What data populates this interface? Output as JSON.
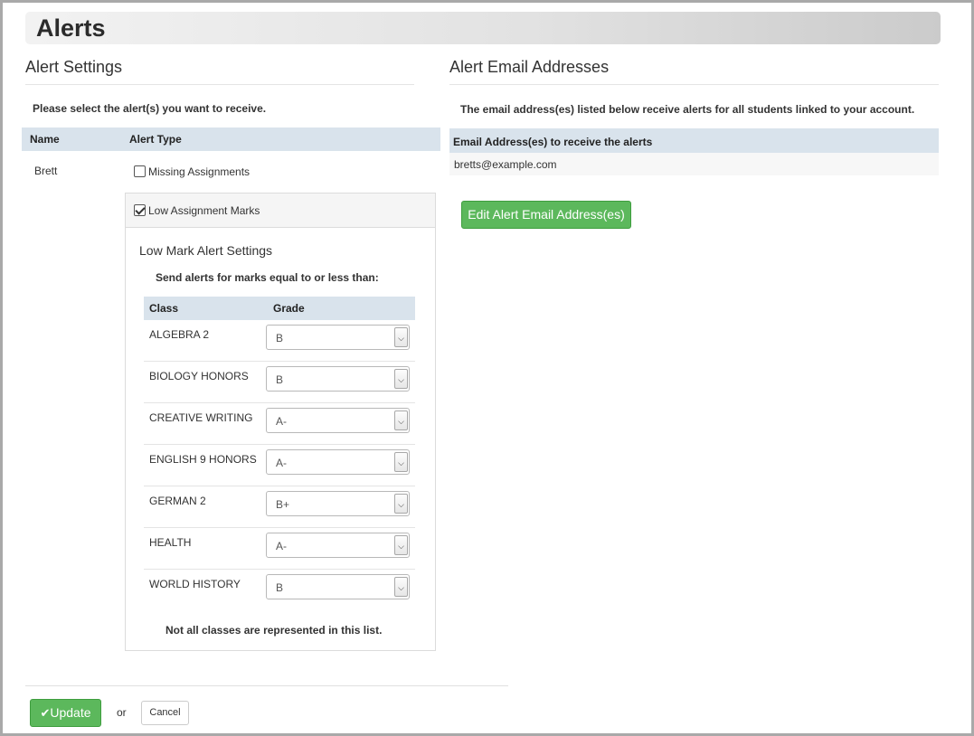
{
  "page": {
    "title": "Alerts"
  },
  "alert_settings": {
    "heading": "Alert Settings",
    "instruction": "Please select the alert(s) you want to receive.",
    "columns": {
      "name": "Name",
      "alert_type": "Alert Type"
    },
    "student": "Brett",
    "alerts": {
      "missing": {
        "label": "Missing Assignments",
        "checked": false
      },
      "low_marks": {
        "label": "Low Assignment Marks",
        "checked": true
      }
    },
    "low_mark": {
      "heading": "Low Mark Alert Settings",
      "instruction": "Send alerts for marks equal to or less than:",
      "columns": {
        "class": "Class",
        "grade": "Grade"
      },
      "rows": [
        {
          "class": "ALGEBRA 2",
          "grade": "B"
        },
        {
          "class": "BIOLOGY HONORS",
          "grade": "B"
        },
        {
          "class": "CREATIVE WRITING",
          "grade": "A-"
        },
        {
          "class": "ENGLISH 9 HONORS",
          "grade": "A-"
        },
        {
          "class": "GERMAN 2",
          "grade": "B+"
        },
        {
          "class": "HEALTH",
          "grade": "A-"
        },
        {
          "class": "WORLD HISTORY",
          "grade": "B"
        }
      ],
      "note": "Not all classes are represented in this list."
    }
  },
  "email_settings": {
    "heading": "Alert Email Addresses",
    "instruction": "The email address(es) listed below receive alerts for all students linked to your account.",
    "column": "Email Address(es) to receive the alerts",
    "addresses": [
      "bretts@example.com"
    ],
    "edit_button": "Edit Alert Email Address(es)"
  },
  "footer": {
    "update_label": "Update",
    "or_label": "or",
    "cancel_label": "Cancel"
  },
  "colors": {
    "button_green": "#5cb85c",
    "table_header": "#d9e3ec"
  },
  "icons": {
    "update": "checkmark-icon",
    "select": "chevron-down-icon"
  }
}
